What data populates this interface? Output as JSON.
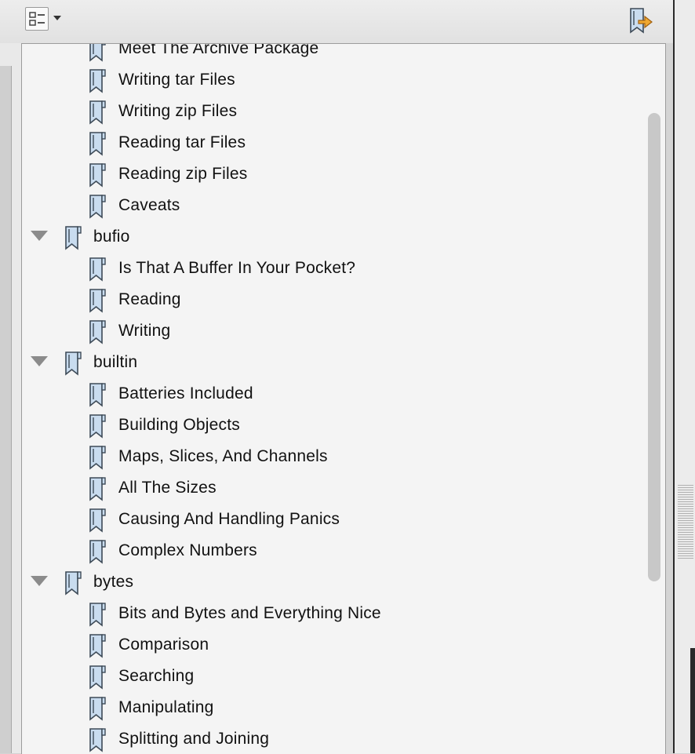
{
  "toolbar": {
    "options_icon": "list-options-icon",
    "options_dropdown_icon": "chevron-down-icon",
    "goto_icon": "bookmark-goto-icon"
  },
  "bookmarks": [
    {
      "label": "Meet The Archive Package",
      "level": 2
    },
    {
      "label": "Writing tar Files",
      "level": 2
    },
    {
      "label": "Writing zip Files",
      "level": 2
    },
    {
      "label": "Reading tar Files",
      "level": 2
    },
    {
      "label": "Reading zip Files",
      "level": 2
    },
    {
      "label": "Caveats",
      "level": 2
    },
    {
      "label": "bufio",
      "level": 1,
      "expanded": true
    },
    {
      "label": "Is That A Buffer In Your Pocket?",
      "level": 2
    },
    {
      "label": "Reading",
      "level": 2
    },
    {
      "label": "Writing",
      "level": 2
    },
    {
      "label": "builtin",
      "level": 1,
      "expanded": true
    },
    {
      "label": "Batteries Included",
      "level": 2
    },
    {
      "label": "Building Objects",
      "level": 2
    },
    {
      "label": "Maps, Slices, And Channels",
      "level": 2
    },
    {
      "label": "All The Sizes",
      "level": 2
    },
    {
      "label": "Causing And Handling Panics",
      "level": 2
    },
    {
      "label": "Complex Numbers",
      "level": 2
    },
    {
      "label": "bytes",
      "level": 1,
      "expanded": true
    },
    {
      "label": "Bits and Bytes and Everything Nice",
      "level": 2
    },
    {
      "label": "Comparison",
      "level": 2
    },
    {
      "label": "Searching",
      "level": 2
    },
    {
      "label": "Manipulating",
      "level": 2
    },
    {
      "label": "Splitting and Joining",
      "level": 2
    }
  ],
  "colors": {
    "bookmark_fill": "#c9dcef",
    "bookmark_stroke": "#3d4a57",
    "disclosure": "#8b8b8b",
    "goto_arrow": "#f0a830"
  }
}
